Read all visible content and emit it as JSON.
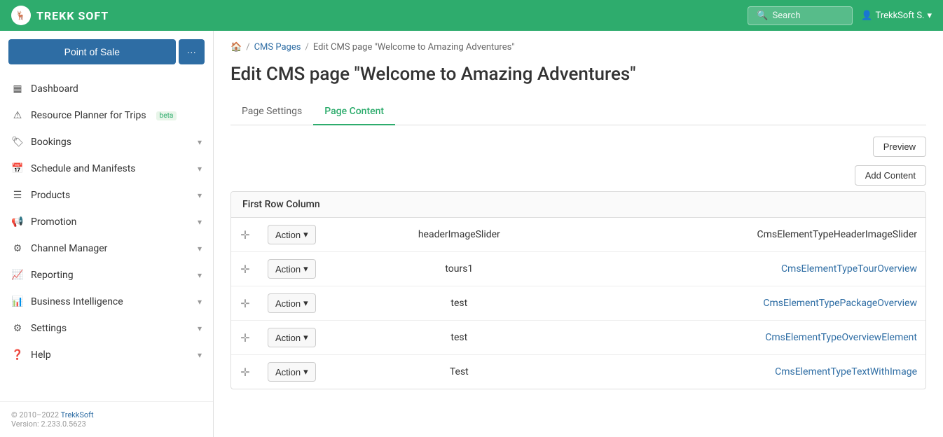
{
  "topNav": {
    "logoText": "TREKK SOFT",
    "searchPlaceholder": "Search",
    "userLabel": "TrekkSoft S.",
    "searchIcon": "🔍"
  },
  "sidebar": {
    "posButton": "Point of Sale",
    "moreButton": "···",
    "navItems": [
      {
        "id": "dashboard",
        "icon": "▦",
        "label": "Dashboard",
        "hasChevron": false
      },
      {
        "id": "resource-planner",
        "icon": "⚠",
        "label": "Resource Planner for Trips",
        "badge": "beta",
        "hasChevron": false
      },
      {
        "id": "bookings",
        "icon": "🏷",
        "label": "Bookings",
        "hasChevron": true
      },
      {
        "id": "schedule",
        "icon": "📅",
        "label": "Schedule and Manifests",
        "hasChevron": true
      },
      {
        "id": "products",
        "icon": "☰",
        "label": "Products",
        "hasChevron": true
      },
      {
        "id": "promotion",
        "icon": "📢",
        "label": "Promotion",
        "hasChevron": true
      },
      {
        "id": "channel-manager",
        "icon": "⚙",
        "label": "Channel Manager",
        "hasChevron": true
      },
      {
        "id": "reporting",
        "icon": "📈",
        "label": "Reporting",
        "hasChevron": true
      },
      {
        "id": "business-intelligence",
        "icon": "📊",
        "label": "Business Intelligence",
        "hasChevron": true
      },
      {
        "id": "settings",
        "icon": "⚙",
        "label": "Settings",
        "hasChevron": true
      },
      {
        "id": "help",
        "icon": "❓",
        "label": "Help",
        "hasChevron": true
      }
    ],
    "footer": {
      "copyright": "© 2010–2022 TrekkSoft",
      "version": "Version: 2.233.0.5623"
    }
  },
  "breadcrumb": {
    "homeIcon": "🏠",
    "items": [
      {
        "label": "CMS Pages",
        "link": true
      },
      {
        "label": "Edit CMS page \"Welcome to Amazing Adventures\"",
        "link": false
      }
    ]
  },
  "pageTitle": "Edit CMS page \"Welcome to Amazing Adventures\"",
  "tabs": [
    {
      "id": "page-settings",
      "label": "Page Settings",
      "active": false
    },
    {
      "id": "page-content",
      "label": "Page Content",
      "active": true
    }
  ],
  "buttons": {
    "preview": "Preview",
    "addContent": "Add Content"
  },
  "contentSection": {
    "title": "First Row Column",
    "rows": [
      {
        "id": 1,
        "actionLabel": "Action",
        "name": "headerImageSlider",
        "type": "CmsElementTypeHeaderImageSlider",
        "typeIsLink": false
      },
      {
        "id": 2,
        "actionLabel": "Action",
        "name": "tours1",
        "type": "CmsElementTypeTourOverview",
        "typeIsLink": true
      },
      {
        "id": 3,
        "actionLabel": "Action",
        "name": "test",
        "type": "CmsElementTypePackageOverview",
        "typeIsLink": true
      },
      {
        "id": 4,
        "actionLabel": "Action",
        "name": "test",
        "type": "CmsElementTypeOverviewElement",
        "typeIsLink": true
      },
      {
        "id": 5,
        "actionLabel": "Action",
        "name": "Test",
        "type": "CmsElementTypeTextWithImage",
        "typeIsLink": true
      }
    ]
  }
}
